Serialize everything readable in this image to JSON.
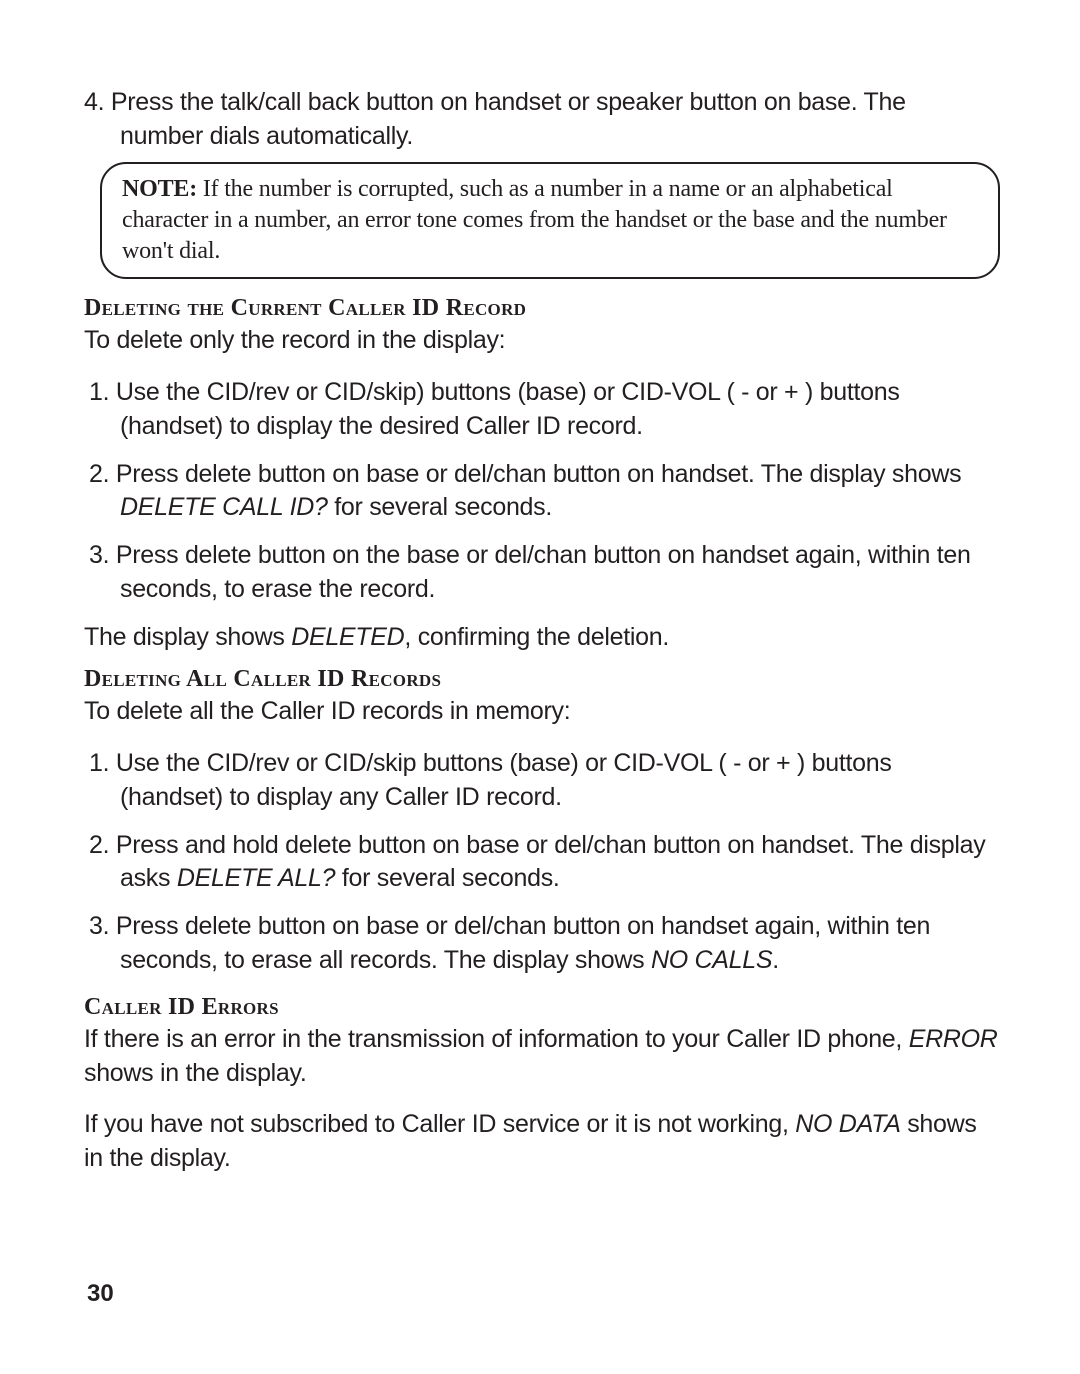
{
  "intro_step": {
    "num": "4.",
    "line1": "Press the talk/call back button on handset or speaker button on base. The",
    "line2": "number dials automatically."
  },
  "note": {
    "label": "NOTE:",
    "body": " If the number is corrupted, such as a number in a name or an alphabetical character in a number, an error tone comes from the handset or the base and the number won't dial."
  },
  "sec_delete_current": {
    "heading": "Deleting the Current Caller ID Record",
    "lead": "To delete only the record in the display:",
    "items": [
      {
        "num": "1.",
        "text_a": "Use the CID/rev or CID/skip) buttons (base) or CID-VOL ( - or + ) buttons (handset) to display the desired Caller ID record.",
        "italic": "",
        "text_b": ""
      },
      {
        "num": "2.",
        "text_a": "Press delete button on base or del/chan button on handset. The display shows ",
        "italic": "DELETE CALL ID?",
        "text_b": " for several seconds."
      },
      {
        "num": "3.",
        "text_a": "Press delete button on the base or del/chan button on handset again, within ten seconds, to erase the record.",
        "italic": "",
        "text_b": ""
      }
    ],
    "followup_a": "The display shows ",
    "followup_italic": "DELETED",
    "followup_b": ", confirming the deletion."
  },
  "sec_delete_all": {
    "heading": "Deleting All Caller ID Records",
    "lead": "To delete all the Caller ID records in memory:",
    "items": [
      {
        "num": "1. ",
        "text_a": "Use the CID/rev or CID/skip buttons (base) or CID-VOL ( - or + ) buttons (handset) to display any Caller ID record.",
        "italic": "",
        "text_b": ""
      },
      {
        "num": "2.",
        "text_a": "Press and hold delete button on base or del/chan button on handset. The display asks ",
        "italic": "DELETE ALL?",
        "text_b": " for several seconds."
      },
      {
        "num": "3.",
        "text_a": "Press delete button on base or del/chan button on handset again, within ten seconds, to erase all records. The display shows ",
        "italic": "NO CALLS",
        "text_b": "."
      }
    ]
  },
  "sec_errors": {
    "heading": "Caller ID Errors",
    "p1_a": "If there is an error in the transmission of information to your Caller ID phone, ",
    "p1_italic": "ERROR",
    "p1_b": " shows in the display.",
    "p2_a": "If you have not subscribed to Caller ID service or it is not working, ",
    "p2_italic": "NO DATA",
    "p2_b": " shows in the display."
  },
  "page_number": "30"
}
